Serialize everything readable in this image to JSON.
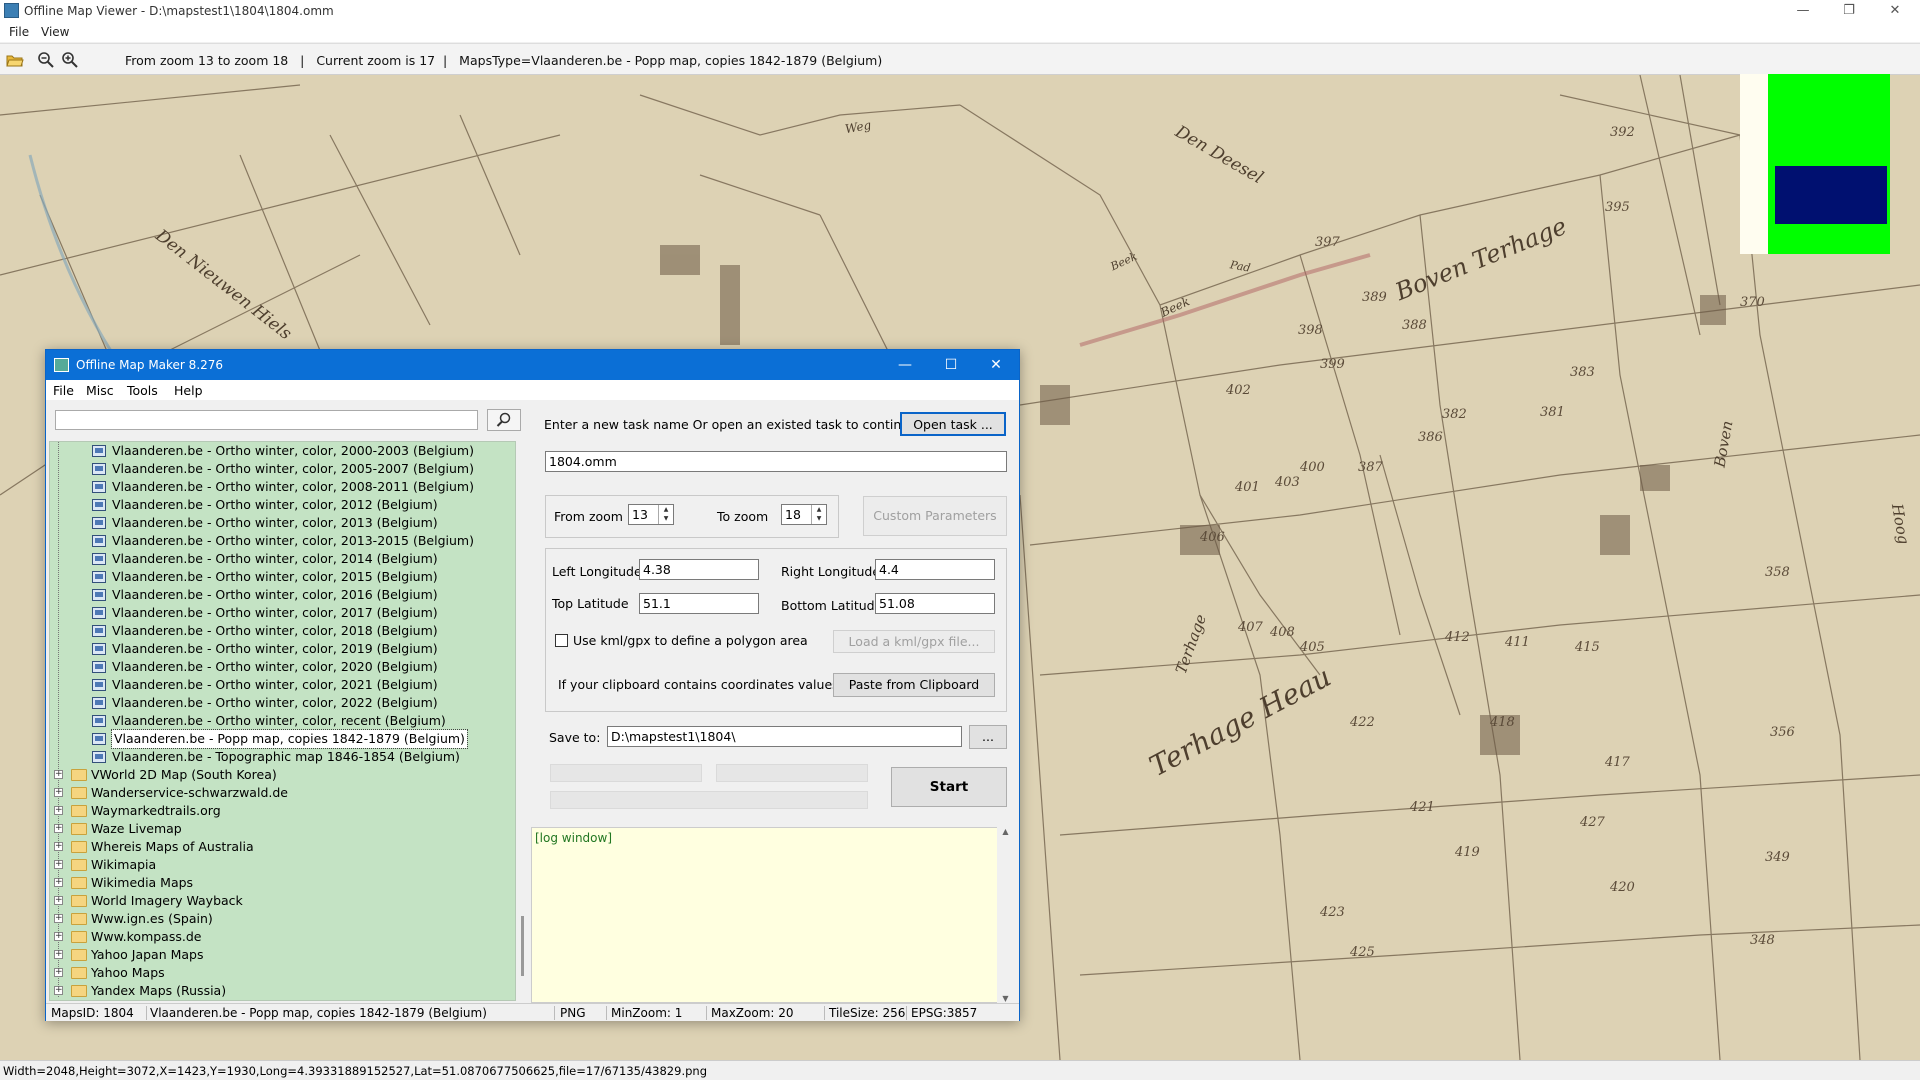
{
  "window": {
    "title": "Offline Map Viewer - D:\\mapstest1\\1804\\1804.omm",
    "menu": [
      "File",
      "View"
    ],
    "controls": {
      "minimize": "—",
      "restore": "❐",
      "close": "✕"
    }
  },
  "toolbar": {
    "icons": [
      "open-folder-icon",
      "zoom-out-icon",
      "zoom-in-icon"
    ],
    "info": "From zoom 13 to zoom 18   |   Current zoom is 17  |   MapsType=Vlaanderen.be - Popp map, copies 1842-1879 (Belgium)"
  },
  "map": {
    "background_color": "#ddd2b4",
    "line_color": "#6b5a45",
    "labels": [
      "Den Nieuwen Hiels",
      "Den Deesel",
      "Boven Terhage",
      "Terhage Heau",
      "Terhage",
      "Boven",
      "Hoog",
      "Beek",
      "Weg",
      "Beek",
      "Pad"
    ],
    "parcel_numbers": [
      "397",
      "389",
      "388",
      "398",
      "402",
      "399",
      "403",
      "401",
      "400",
      "387",
      "386",
      "382",
      "381",
      "383",
      "406",
      "407",
      "408",
      "405",
      "412",
      "411",
      "415",
      "418",
      "417",
      "419",
      "420",
      "421",
      "422",
      "423",
      "425",
      "427",
      "392",
      "395",
      "370",
      "358",
      "356",
      "349",
      "348"
    ],
    "minimap": {
      "outer": "#00ff00",
      "inner": "#001070",
      "bg": "#fffdf0"
    }
  },
  "statusbar": {
    "text": "Width=2048,Height=3072,X=1423,Y=1930,Long=4.39331889152527,Lat=51.0870677506625,file=17/67135/43829.png"
  },
  "dialog": {
    "title": "Offline Map Maker 8.276",
    "menu": [
      "File",
      "Misc",
      "Tools",
      "Help"
    ],
    "search": {
      "value": "",
      "placeholder": ""
    },
    "tree": {
      "map_items": [
        "Vlaanderen.be - Ortho winter, color, 2000-2003 (Belgium)",
        "Vlaanderen.be - Ortho winter, color, 2005-2007 (Belgium)",
        "Vlaanderen.be - Ortho winter, color, 2008-2011 (Belgium)",
        "Vlaanderen.be - Ortho winter, color, 2012 (Belgium)",
        "Vlaanderen.be - Ortho winter, color, 2013 (Belgium)",
        "Vlaanderen.be - Ortho winter, color, 2013-2015 (Belgium)",
        "Vlaanderen.be - Ortho winter, color, 2014 (Belgium)",
        "Vlaanderen.be - Ortho winter, color, 2015 (Belgium)",
        "Vlaanderen.be - Ortho winter, color, 2016 (Belgium)",
        "Vlaanderen.be - Ortho winter, color, 2017 (Belgium)",
        "Vlaanderen.be - Ortho winter, color, 2018 (Belgium)",
        "Vlaanderen.be - Ortho winter, color, 2019 (Belgium)",
        "Vlaanderen.be - Ortho winter, color, 2020 (Belgium)",
        "Vlaanderen.be - Ortho winter, color, 2021 (Belgium)",
        "Vlaanderen.be - Ortho winter, color, 2022 (Belgium)",
        "Vlaanderen.be - Ortho winter, color, recent (Belgium)",
        "Vlaanderen.be - Popp map, copies 1842-1879 (Belgium)",
        "Vlaanderen.be - Topographic map 1846-1854 (Belgium)"
      ],
      "selected_index": 16,
      "folders": [
        "VWorld 2D Map (South Korea)",
        "Wanderservice-schwarzwald.de",
        "Waymarkedtrails.org",
        "Waze Livemap",
        "Whereis Maps of Australia",
        "Wikimapia",
        "Wikimedia Maps",
        "World Imagery Wayback",
        "Www.ign.es (Spain)",
        "Www.kompass.de",
        "Yahoo Japan Maps",
        "Yahoo Maps",
        "Yandex Maps (Russia)"
      ]
    },
    "task": {
      "prompt": "Enter a new task name Or open an existed task to continue:",
      "open_button": "Open task ...",
      "name_value": "1804.omm"
    },
    "zoom": {
      "from_label": "From zoom",
      "from_value": "13",
      "to_label": "To zoom",
      "to_value": "18",
      "custom_button": "Custom Parameters"
    },
    "coords": {
      "left_lon_label": "Left Longitude",
      "left_lon_value": "4.38",
      "right_lon_label": "Right Longitude",
      "right_lon_value": "4.4",
      "top_lat_label": "Top Latitude",
      "top_lat_value": "51.1",
      "bottom_lat_label": "Bottom Latitude",
      "bottom_lat_value": "51.08",
      "kml_checkbox_label": "Use kml/gpx to define a polygon area",
      "kml_checked": false,
      "load_kml_button": "Load a kml/gpx file...",
      "clipboard_label": "If your clipboard contains coordinates values:",
      "paste_button": "Paste from Clipboard"
    },
    "save": {
      "label": "Save to:",
      "path": "D:\\mapstest1\\1804\\",
      "browse_button": "...",
      "start_button": "Start"
    },
    "log": {
      "text": "[log window]"
    },
    "status": {
      "maps_id": "MapsID: 1804",
      "map_name": "Vlaanderen.be - Popp map, copies 1842-1879 (Belgium)",
      "format": "PNG",
      "min_zoom": "MinZoom: 1",
      "max_zoom": "MaxZoom: 20",
      "tile_size": "TileSize: 256",
      "epsg": "EPSG:3857"
    }
  }
}
